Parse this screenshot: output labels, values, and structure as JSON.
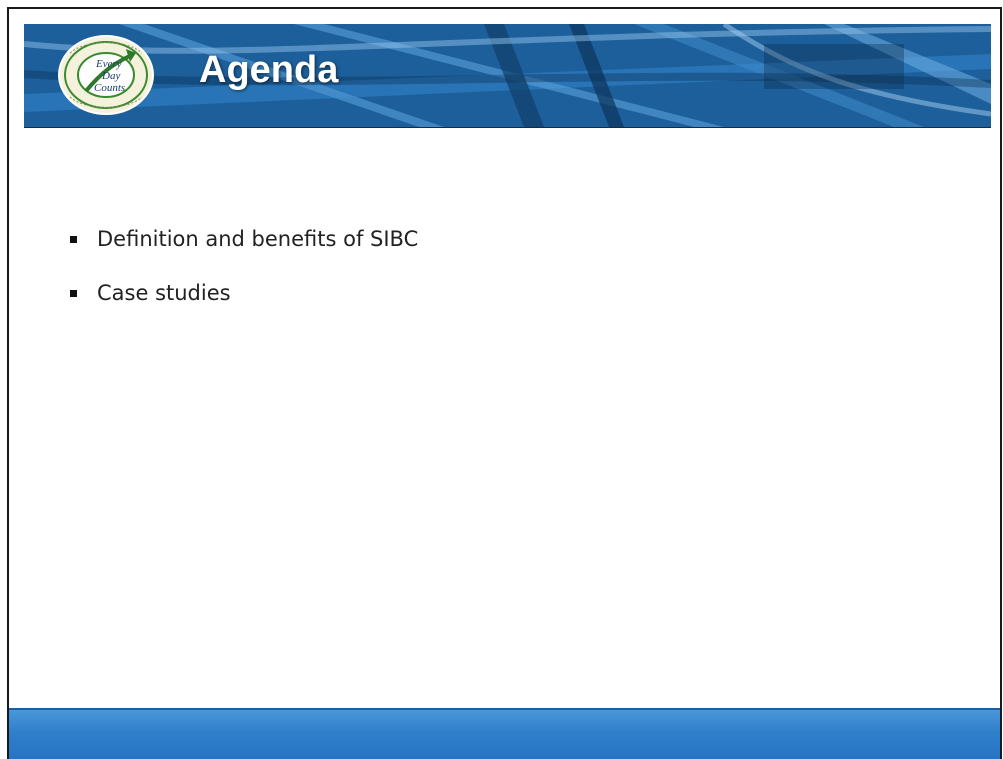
{
  "slide": {
    "title": "Agenda",
    "logo": {
      "icon": "every-day-counts-logo",
      "text_lines": [
        "Every",
        "Day",
        "Counts"
      ],
      "ring_text": "Innovation · Deployment · Implementation · Acceleration"
    },
    "bullets": [
      "Definition and benefits of SIBC",
      "Case studies"
    ]
  },
  "colors": {
    "header_blue": "#1f6aa8",
    "footer_blue": "#2f7fcb",
    "logo_green": "#3a8a2f"
  }
}
